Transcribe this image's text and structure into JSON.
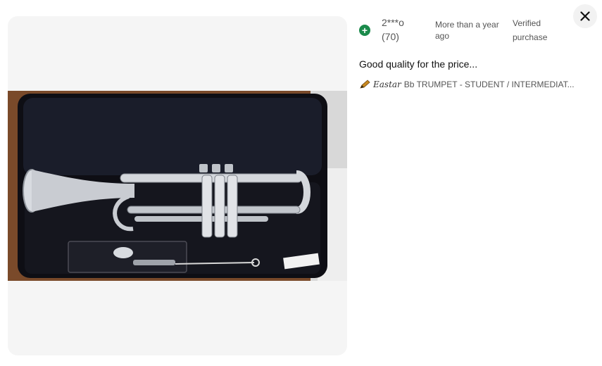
{
  "reviewer": {
    "name": "2***o",
    "count": "(70)",
    "avatar_icon": "plus-circle-icon",
    "avatar_color": "#1a8a4b"
  },
  "review": {
    "date": "More than a year ago",
    "verified": "Verified purchase",
    "text": "Good quality for the price..."
  },
  "product": {
    "icon": "pencil-brand-icon",
    "brand": "Eastar",
    "name": "Bb TRUMPET - STUDENT / INTERMEDIAT..."
  },
  "close_icon": "close-icon",
  "photo": {
    "label": "trumpet-in-case-photo"
  }
}
